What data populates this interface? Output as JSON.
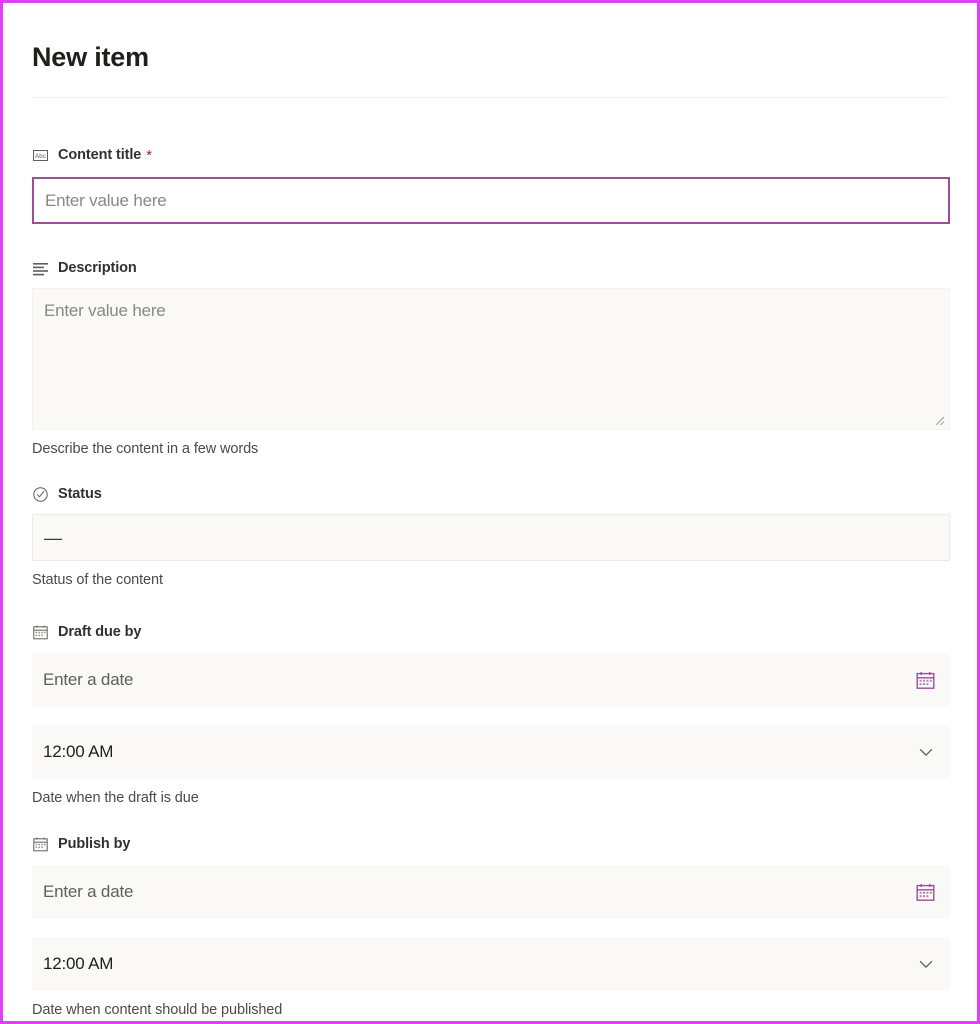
{
  "panel": {
    "title": "New item"
  },
  "fields": [
    {
      "id": "content-title",
      "icon": "abc-text-icon",
      "label": "Content title",
      "required": true,
      "required_marker": "*",
      "control": "text",
      "placeholder": "Enter value here",
      "value": "",
      "description": ""
    },
    {
      "id": "description",
      "icon": "multiline-text-icon",
      "label": "Description",
      "required": false,
      "control": "textarea",
      "placeholder": "Enter value here",
      "value": "",
      "description": "Describe the content in a few words"
    },
    {
      "id": "status",
      "icon": "circle-check-icon",
      "label": "Status",
      "required": false,
      "control": "status",
      "value": "—",
      "description": "Status of the content"
    },
    {
      "id": "draft-due-by",
      "icon": "calendar-icon",
      "label": "Draft due by",
      "required": false,
      "control": "datetime",
      "date_placeholder": "Enter a date",
      "date_value": "",
      "time_value": "12:00 AM",
      "date_picker_icon": "calendar-icon",
      "time_dropdown_icon": "chevron-down-icon",
      "description": "Date when the draft is due"
    },
    {
      "id": "publish-by",
      "icon": "calendar-icon",
      "label": "Publish by",
      "required": false,
      "control": "datetime",
      "date_placeholder": "Enter a date",
      "date_value": "",
      "time_value": "12:00 AM",
      "date_picker_icon": "calendar-icon",
      "time_dropdown_icon": "chevron-down-icon",
      "description": "Date when content should be published"
    }
  ],
  "colors": {
    "frame_border": "#e040fb",
    "focus_border": "#9b4f96",
    "accent": "#9b4f96",
    "required_star": "#a4262c",
    "field_fill": "#faf9f8",
    "label_text": "#323130",
    "placeholder_text": "#8a8886"
  }
}
